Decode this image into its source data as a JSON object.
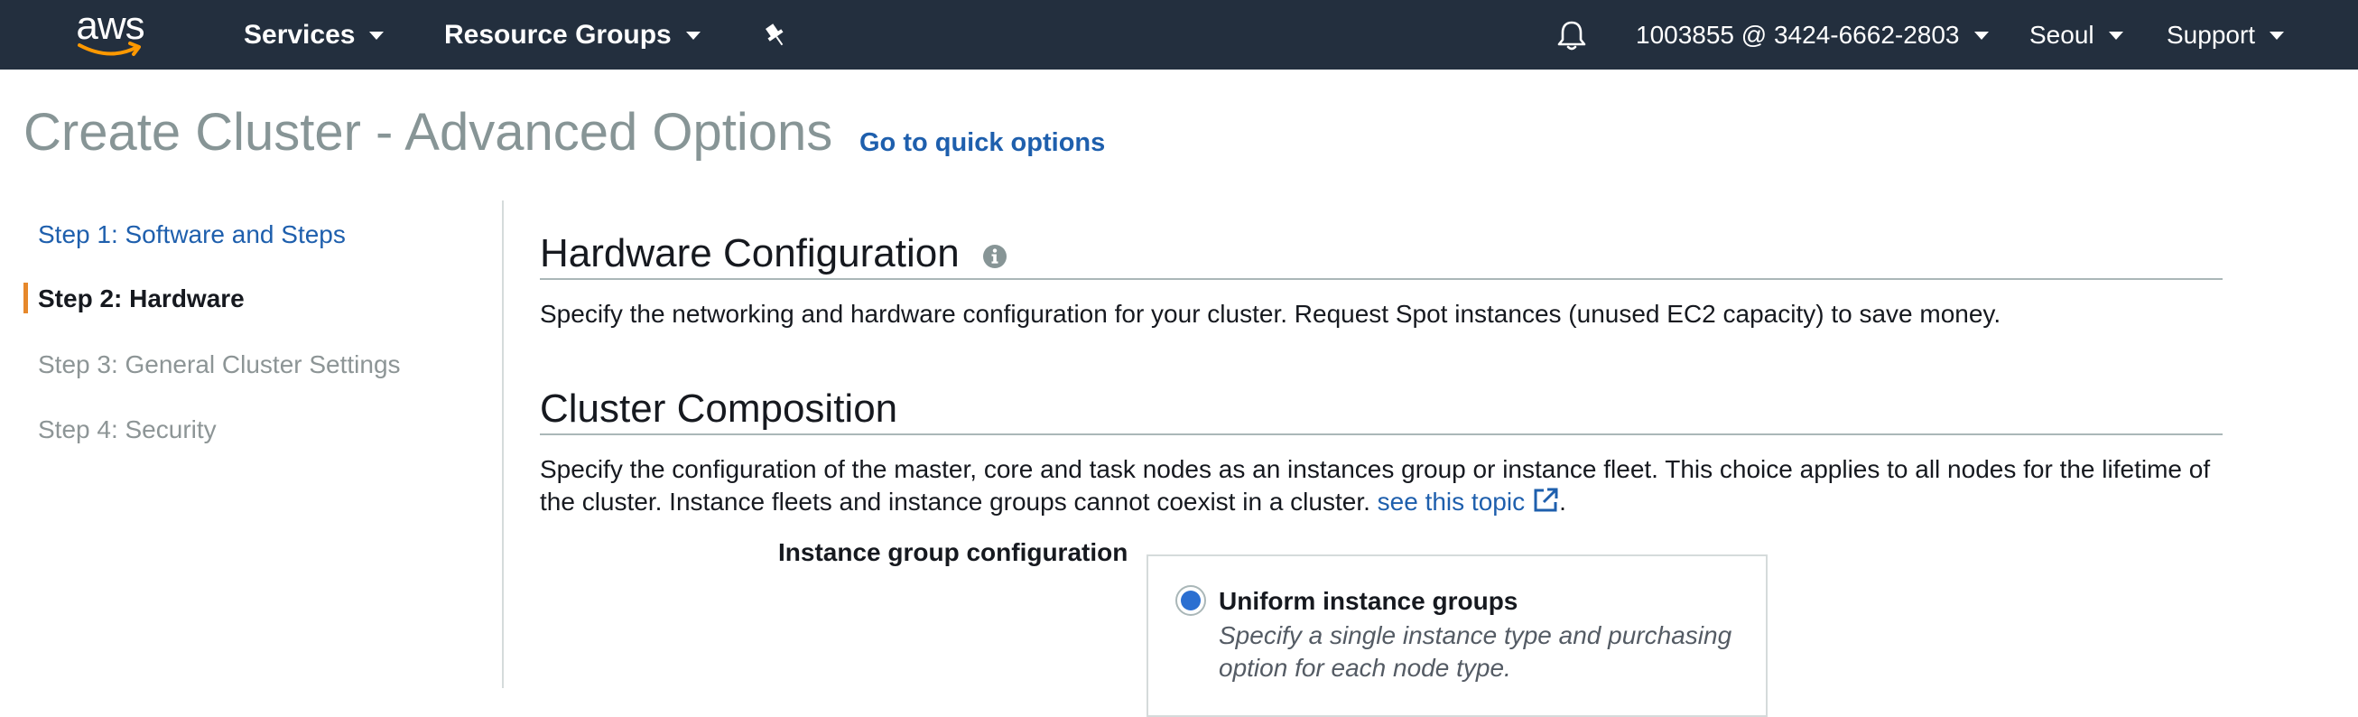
{
  "brand": {
    "logo_text": "aws"
  },
  "nav": {
    "services": "Services",
    "resource_groups": "Resource Groups",
    "account": "1003855 @ 3424-6662-2803",
    "region": "Seoul",
    "support": "Support",
    "pin_icon": "pin-icon",
    "bell_icon": "bell-icon"
  },
  "page": {
    "title": "Create Cluster - Advanced Options",
    "quick_options_link": "Go to quick options"
  },
  "steps": [
    {
      "label": "Step 1: Software and Steps",
      "state": "link"
    },
    {
      "label": "Step 2: Hardware",
      "state": "active"
    },
    {
      "label": "Step 3: General Cluster Settings",
      "state": "disabled"
    },
    {
      "label": "Step 4: Security",
      "state": "disabled"
    }
  ],
  "hardware": {
    "title": "Hardware Configuration",
    "description": "Specify the networking and hardware configuration for your cluster. Request Spot instances (unused EC2 capacity) to save money."
  },
  "composition": {
    "title": "Cluster Composition",
    "description": "Specify the configuration of the master, core and task nodes as an instances group or instance fleet. This choice applies to all nodes for the lifetime of the cluster. Instance fleets and instance groups cannot coexist in a cluster.",
    "link_text": "see this topic",
    "trailing": ".",
    "field_label": "Instance group configuration",
    "option": {
      "title": "Uniform instance groups",
      "description": "Specify a single instance type and purchasing option for each node type.",
      "selected": true
    }
  },
  "colors": {
    "nav_bg": "#232f3e",
    "link": "#1e5fad",
    "active_marker": "#e6882b",
    "radio_selected": "#2b6fd1"
  }
}
